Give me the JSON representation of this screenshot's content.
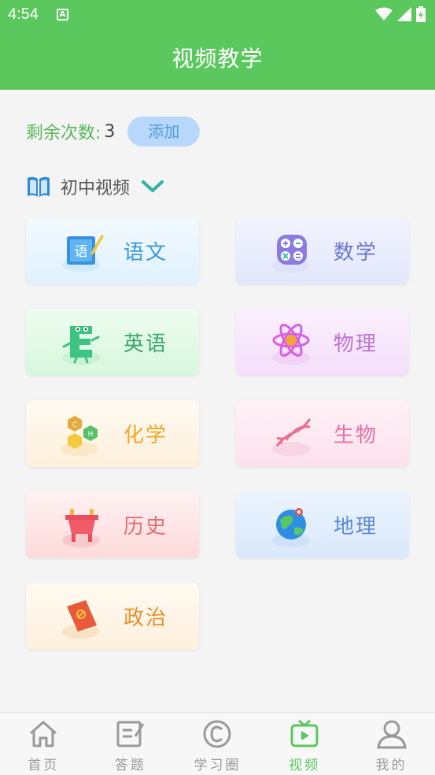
{
  "status": {
    "time": "4:54",
    "notif": "A"
  },
  "header": {
    "title": "视频教学"
  },
  "remaining": {
    "label": "剩余次数:",
    "count": "3",
    "add_label": "添加"
  },
  "level": {
    "label": "初中视频"
  },
  "subjects": [
    {
      "name": "语文",
      "color": "#3a9ad9",
      "bg": "#e3f3fd",
      "icon": "chinese-book-icon"
    },
    {
      "name": "数学",
      "color": "#6a78cf",
      "bg": "#e8ebfc",
      "icon": "calculator-icon"
    },
    {
      "name": "英语",
      "color": "#37a96b",
      "bg": "#ddf8e3",
      "icon": "letter-e-icon"
    },
    {
      "name": "物理",
      "color": "#bb72d6",
      "bg": "#f7e4fb",
      "icon": "atom-icon"
    },
    {
      "name": "化学",
      "color": "#efa623",
      "bg": "#fdf3e2",
      "icon": "molecule-icon"
    },
    {
      "name": "生物",
      "color": "#e470a8",
      "bg": "#fde7f1",
      "icon": "dna-icon"
    },
    {
      "name": "历史",
      "color": "#e86c72",
      "bg": "#fde0e1",
      "icon": "ancient-vessel-icon"
    },
    {
      "name": "地理",
      "color": "#5b87d1",
      "bg": "#e1ecfc",
      "icon": "globe-icon"
    },
    {
      "name": "政治",
      "color": "#e9902b",
      "bg": "#fdf0e1",
      "icon": "party-book-icon"
    }
  ],
  "tabs": [
    {
      "label": "首页",
      "icon": "home-icon",
      "active": false
    },
    {
      "label": "答题",
      "icon": "edit-icon",
      "active": false
    },
    {
      "label": "学习圈",
      "icon": "copyright-circle-icon",
      "active": false
    },
    {
      "label": "视频",
      "icon": "tv-icon",
      "active": true
    },
    {
      "label": "我的",
      "icon": "person-icon",
      "active": false
    }
  ],
  "colors": {
    "primary": "#5bc85d",
    "accent_blue": "#4b9ad8"
  }
}
